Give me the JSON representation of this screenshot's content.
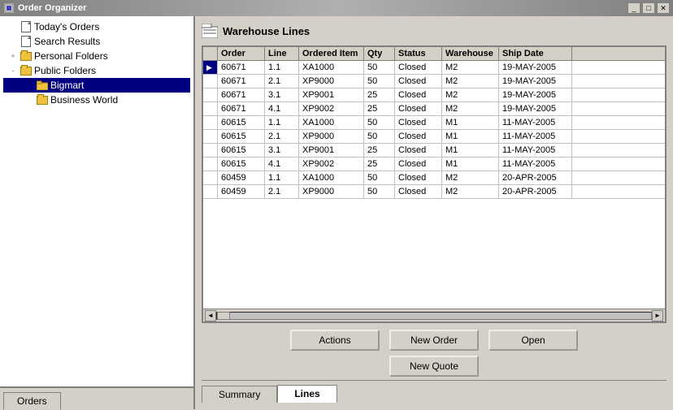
{
  "titleBar": {
    "title": "Order Organizer",
    "minBtn": "🗕",
    "maxBtn": "🗖",
    "closeBtn": "✕"
  },
  "tree": {
    "items": [
      {
        "id": "todays-orders",
        "label": "Today's Orders",
        "indent": 1,
        "type": "doc",
        "expanded": false
      },
      {
        "id": "search-results",
        "label": "Search Results",
        "indent": 1,
        "type": "doc",
        "expanded": false
      },
      {
        "id": "personal-folders",
        "label": "Personal Folders",
        "indent": 1,
        "type": "folder",
        "expanded": false
      },
      {
        "id": "public-folders",
        "label": "Public Folders",
        "indent": 1,
        "type": "folder",
        "expanded": true
      },
      {
        "id": "bigmart",
        "label": "Bigmart",
        "indent": 2,
        "type": "folder",
        "selected": true
      },
      {
        "id": "business-world",
        "label": "Business World",
        "indent": 2,
        "type": "folder"
      }
    ]
  },
  "leftBottomTab": {
    "label": "Orders"
  },
  "rightPanel": {
    "title": "Warehouse Lines",
    "columns": [
      {
        "id": "sel",
        "label": ""
      },
      {
        "id": "order",
        "label": "Order"
      },
      {
        "id": "line",
        "label": "Line"
      },
      {
        "id": "item",
        "label": "Ordered Item"
      },
      {
        "id": "qty",
        "label": "Qty"
      },
      {
        "id": "status",
        "label": "Status"
      },
      {
        "id": "warehouse",
        "label": "Warehouse"
      },
      {
        "id": "shipdate",
        "label": "Ship Date"
      }
    ],
    "rows": [
      {
        "sel": true,
        "order": "60671",
        "line": "1.1",
        "item": "XA1000",
        "qty": "50",
        "status": "Closed",
        "warehouse": "M2",
        "shipdate": "19-MAY-2005"
      },
      {
        "sel": false,
        "order": "60671",
        "line": "2.1",
        "item": "XP9000",
        "qty": "50",
        "status": "Closed",
        "warehouse": "M2",
        "shipdate": "19-MAY-2005"
      },
      {
        "sel": false,
        "order": "60671",
        "line": "3.1",
        "item": "XP9001",
        "qty": "25",
        "status": "Closed",
        "warehouse": "M2",
        "shipdate": "19-MAY-2005"
      },
      {
        "sel": false,
        "order": "60671",
        "line": "4.1",
        "item": "XP9002",
        "qty": "25",
        "status": "Closed",
        "warehouse": "M2",
        "shipdate": "19-MAY-2005"
      },
      {
        "sel": false,
        "order": "60615",
        "line": "1.1",
        "item": "XA1000",
        "qty": "50",
        "status": "Closed",
        "warehouse": "M1",
        "shipdate": "11-MAY-2005"
      },
      {
        "sel": false,
        "order": "60615",
        "line": "2.1",
        "item": "XP9000",
        "qty": "50",
        "status": "Closed",
        "warehouse": "M1",
        "shipdate": "11-MAY-2005"
      },
      {
        "sel": false,
        "order": "60615",
        "line": "3.1",
        "item": "XP9001",
        "qty": "25",
        "status": "Closed",
        "warehouse": "M1",
        "shipdate": "11-MAY-2005"
      },
      {
        "sel": false,
        "order": "60615",
        "line": "4.1",
        "item": "XP9002",
        "qty": "25",
        "status": "Closed",
        "warehouse": "M1",
        "shipdate": "11-MAY-2005"
      },
      {
        "sel": false,
        "order": "60459",
        "line": "1.1",
        "item": "XA1000",
        "qty": "50",
        "status": "Closed",
        "warehouse": "M2",
        "shipdate": "20-APR-2005"
      },
      {
        "sel": false,
        "order": "60459",
        "line": "2.1",
        "item": "XP9000",
        "qty": "50",
        "status": "Closed",
        "warehouse": "M2",
        "shipdate": "20-APR-2005"
      }
    ],
    "buttons": {
      "actions": "Actions",
      "newOrder": "New Order",
      "open": "Open",
      "newQuote": "New Quote"
    },
    "tabs": [
      {
        "id": "summary",
        "label": "Summary"
      },
      {
        "id": "lines",
        "label": "Lines"
      }
    ],
    "activeTab": "lines"
  }
}
